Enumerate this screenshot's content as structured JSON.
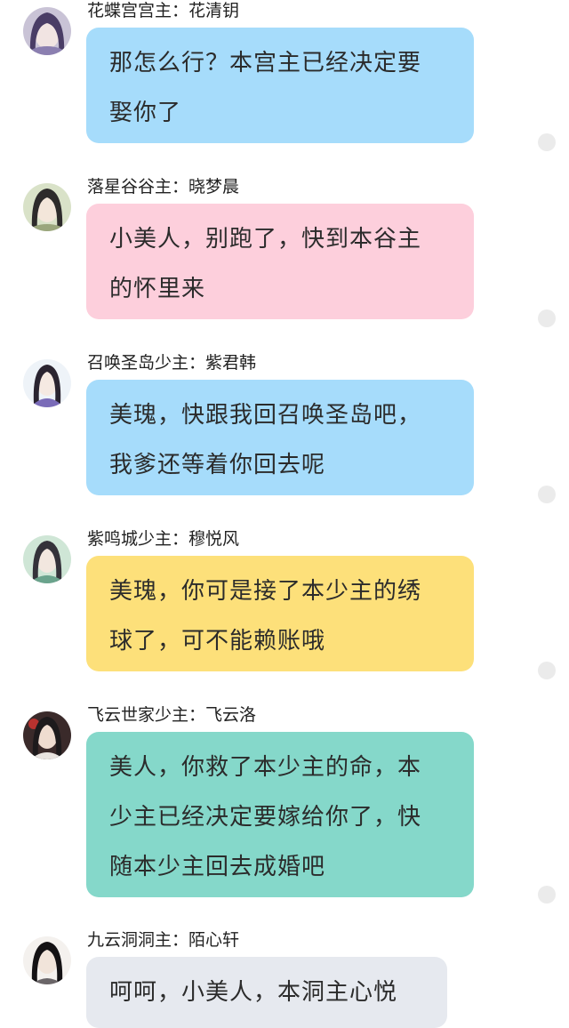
{
  "messages": [
    {
      "name": "花蝶宫宫主：花清钥",
      "lines": [
        "那怎么行？本宫主已经决定要",
        "娶你了"
      ],
      "color": "#a6dcfb",
      "avatar": "avatar-1"
    },
    {
      "name": "落星谷谷主：晓梦晨",
      "lines": [
        "小美人，别跑了，快到本谷主",
        "的怀里来"
      ],
      "color": "#fdcfdc",
      "avatar": "avatar-2"
    },
    {
      "name": "召唤圣岛少主：紫君韩",
      "lines": [
        "美瑰，快跟我回召唤圣岛吧，",
        "我爹还等着你回去呢"
      ],
      "color": "#a6dcfb",
      "avatar": "avatar-3"
    },
    {
      "name": "紫鸣城少主：穆悦风",
      "lines": [
        "美瑰，你可是接了本少主的绣",
        "球了，可不能赖账哦"
      ],
      "color": "#fde07a",
      "avatar": "avatar-4"
    },
    {
      "name": "飞云世家少主：飞云洛",
      "lines": [
        "美人，你救了本少主的命，本",
        "少主已经决定要嫁给你了，快",
        "随本少主回去成婚吧"
      ],
      "color": "#85d8ca",
      "avatar": "avatar-5"
    },
    {
      "name": "九云洞洞主：陌心轩",
      "lines": [
        "呵呵，小美人，本洞主心悦"
      ],
      "color": "#e6e9ef",
      "avatar": "avatar-6"
    }
  ]
}
